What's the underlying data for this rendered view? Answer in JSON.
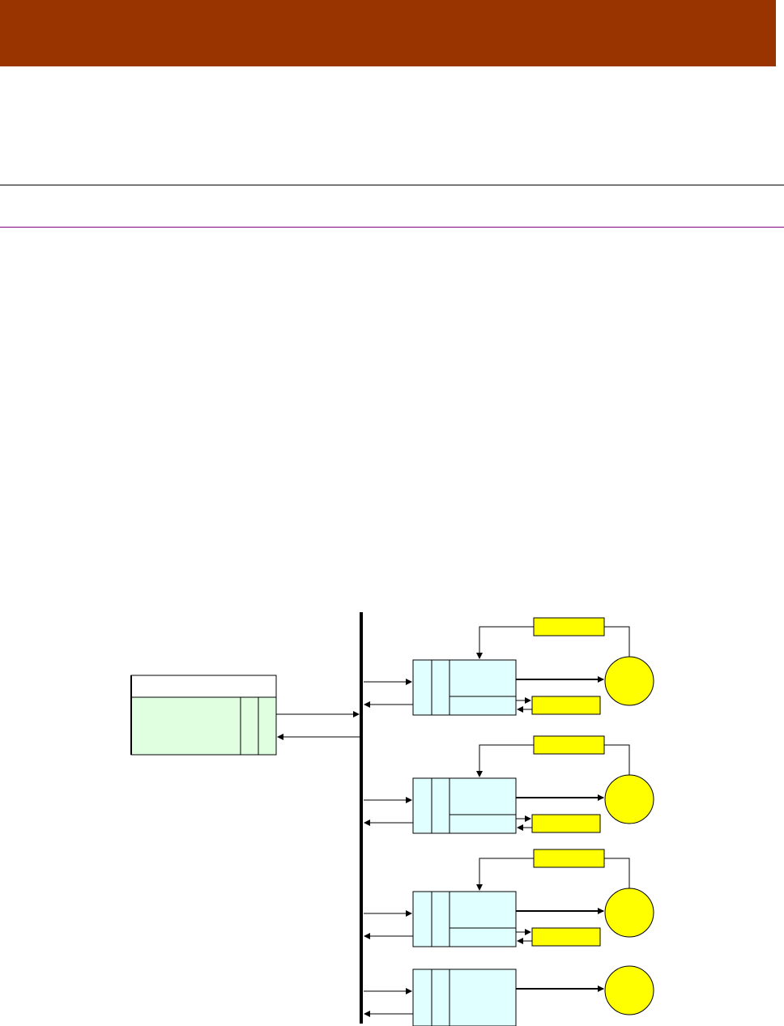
{
  "slide": {
    "title": ""
  },
  "colors": {
    "header": "#993300",
    "host_fill": "#e0ffe0",
    "module_fill": "#e0ffff",
    "yellow_fill": "#ffff00",
    "stroke": "#000000",
    "rule_purple": "#800080"
  },
  "diagram": {
    "host": {
      "label": ""
    },
    "modules": [
      {
        "label": "",
        "has_feedback": true,
        "has_status_box": true
      },
      {
        "label": "",
        "has_feedback": true,
        "has_status_box": true
      },
      {
        "label": "",
        "has_feedback": true,
        "has_status_box": true
      },
      {
        "label": "",
        "has_feedback": false,
        "has_status_box": false
      }
    ]
  }
}
